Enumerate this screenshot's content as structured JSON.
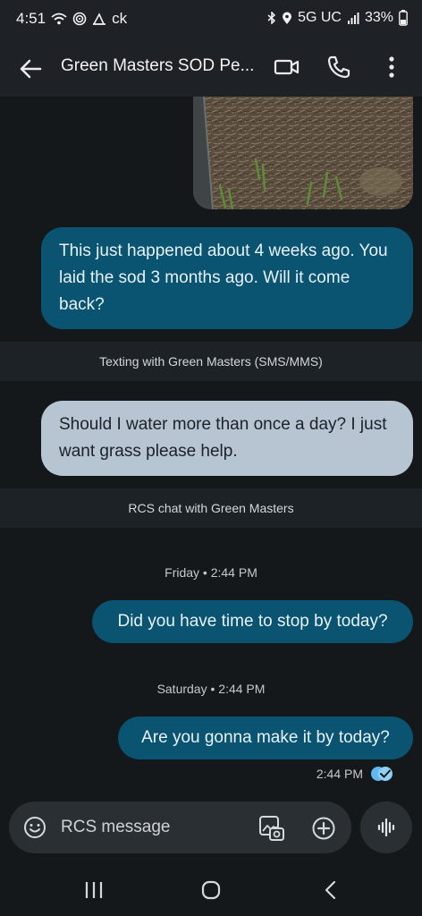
{
  "status": {
    "time": "4:51",
    "carrier_label": "ck",
    "network": "5G UC",
    "battery": "33%"
  },
  "header": {
    "title": "Green Masters SOD Pe...",
    "icons": [
      "back-arrow-icon",
      "video-icon",
      "phone-icon",
      "more-vert-icon"
    ]
  },
  "messages": {
    "m1": "This just happened about 4 weeks ago. You laid the sod 3 months ago. Will it come back?",
    "banner_sms": "Texting with Green Masters (SMS/MMS)",
    "m2": "Should I water more than once a day? I just want grass please help.",
    "banner_rcs": "RCS chat with Green Masters",
    "ts1": "Friday • 2:44 PM",
    "m3": "Did you have time to stop by today?",
    "ts2": "Saturday • 2:44 PM",
    "m4": "Are you gonna make it by today?",
    "receipt_time": "2:44 PM"
  },
  "composer": {
    "placeholder": "RCS message"
  },
  "colors": {
    "outgoing_bubble": "#0a5371",
    "incoming_bubble": "#b7c4d1",
    "read_receipt": "#5fb8ee"
  }
}
